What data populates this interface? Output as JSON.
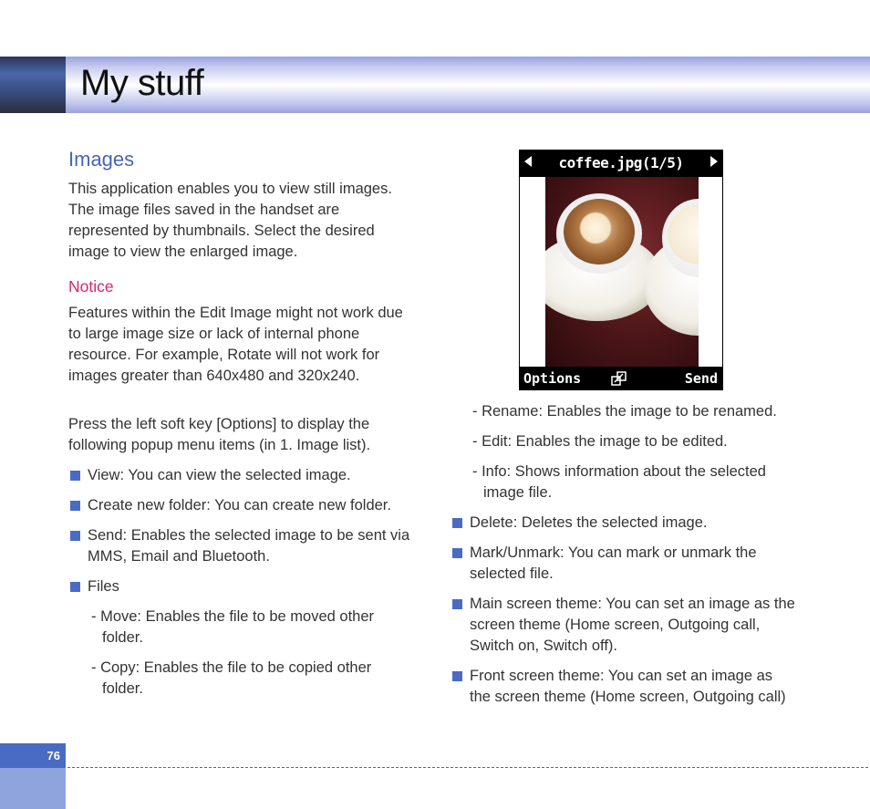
{
  "page": {
    "title": "My stuff",
    "page_number": "76"
  },
  "left_column": {
    "heading": "Images",
    "intro": "This application enables you to view still images. The image files saved in the handset are represented by thumbnails. Select the desired image to view the enlarged image.",
    "notice_heading": "Notice",
    "notice_text": "Features within the Edit Image might not work due to large image size or lack of internal phone resource. For example, Rotate will not work for images greater than 640x480 and 320x240.",
    "options_text": "Press the left soft key [Options] to display the following popup menu items (in 1. Image list).",
    "bullets": [
      "View: You can view the selected image.",
      "Create new folder: You can create new folder.",
      "Send: Enables the selected image to be sent via MMS, Email and Bluetooth.",
      "Files"
    ],
    "files_subitems": [
      "- Move: Enables the file to be moved other folder.",
      "- Copy: Enables the file to be copied other folder."
    ]
  },
  "phone_screen": {
    "title": "coffee.jpg(1/5)",
    "left_softkey": "Options",
    "right_softkey": "Send",
    "left_arrow_icon": "arrow-left-icon",
    "right_arrow_icon": "arrow-right-icon",
    "center_icon": "zoom-icon"
  },
  "right_column": {
    "subitems": [
      "- Rename: Enables the image to be renamed.",
      "- Edit: Enables the image to be edited.",
      "- Info: Shows information about the selected image file."
    ],
    "bullets": [
      "Delete: Deletes the selected image.",
      "Mark/Unmark: You can mark or unmark the selected file.",
      "Main screen theme: You can set an image as the screen theme (Home screen, Outgoing call, Switch on, Switch off).",
      "Front screen theme: You can set an image as the screen theme (Home screen, Outgoing call)"
    ]
  },
  "colors": {
    "heading_blue": "#4566b8",
    "notice_pink": "#d6266f",
    "bullet_blue": "#4a6bc4"
  }
}
